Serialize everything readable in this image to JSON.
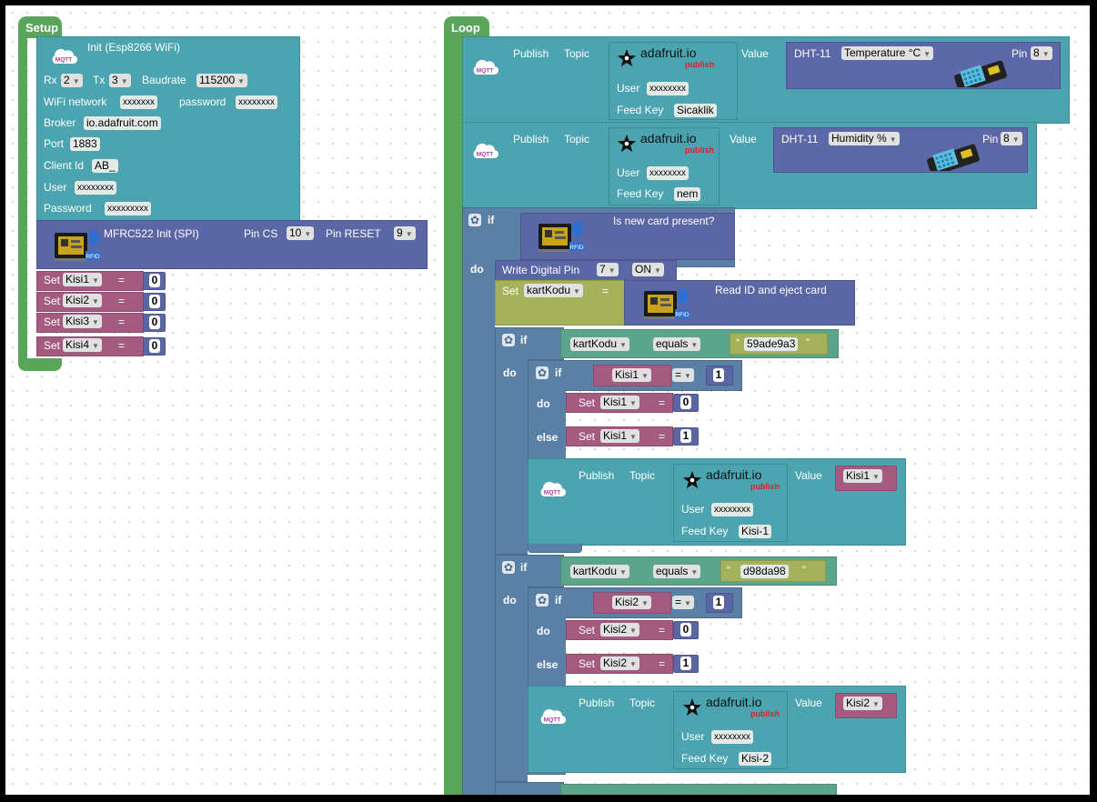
{
  "setup": {
    "label": "Setup",
    "init_title": "Init (Esp8266 WiFi)",
    "mqtt_label": "MQTT",
    "rx_label": "Rx",
    "rx_value": "2",
    "tx_label": "Tx",
    "tx_value": "3",
    "baud_label": "Baudrate",
    "baud_value": "115200",
    "wifi_label": "WiFi network",
    "wifi_value": "xxxxxxx",
    "password_label": "password",
    "password_value": "xxxxxxxx",
    "broker_label": "Broker",
    "broker_value": "io.adafruit.com",
    "port_label": "Port",
    "port_value": "1883",
    "client_label": "Client Id",
    "client_value": "AB_",
    "user_label": "User",
    "user_value": "xxxxxxxx",
    "pass2_label": "Password",
    "pass2_value": "xxxxxxxxx",
    "rfid_title": "MFRC522 Init (SPI)",
    "pin_cs_label": "Pin CS",
    "pin_cs_value": "10",
    "pin_reset_label": "Pin RESET",
    "pin_reset_value": "9",
    "rfid_tag": "RFID",
    "set_label": "Set",
    "eq": "=",
    "vars": [
      {
        "name": "Kisi1",
        "value": "0"
      },
      {
        "name": "Kisi2",
        "value": "0"
      },
      {
        "name": "Kisi3",
        "value": "0"
      },
      {
        "name": "Kisi4",
        "value": "0"
      }
    ]
  },
  "loop": {
    "label": "Loop",
    "publish_label": "Publish",
    "topic_label": "Topic",
    "value_label": "Value",
    "adafruit": "adafruit.io",
    "adafruit_sub": "publish",
    "user_label": "User",
    "feed_label": "Feed Key",
    "user_value": "xxxxxxxx",
    "pub1": {
      "feed": "Sicaklik",
      "sensor": "DHT-11",
      "measure": "Temperature °C",
      "pin_label": "Pin",
      "pin": "8"
    },
    "pub2": {
      "feed": "nem",
      "sensor": "DHT-11",
      "measure": "Humidity %",
      "pin_label": "Pin",
      "pin": "8"
    },
    "if_label": "if",
    "do_label": "do",
    "else_label": "else",
    "card_present": "Is new card present?",
    "write_pin_label": "Write Digital Pin",
    "write_pin": "7",
    "write_state": "ON",
    "set_label": "Set",
    "kart_var": "kartKodu",
    "eq": "=",
    "read_id": "Read ID and eject card",
    "equals": "equals",
    "q_open": "“",
    "q_close": "”",
    "card1": "59ade9a3",
    "card2": "d98da98",
    "kisi1": {
      "name": "Kisi1",
      "cmp": "=",
      "one": "1",
      "zero": "0",
      "feed": "Kisi-1"
    },
    "kisi2": {
      "name": "Kisi2",
      "cmp": "=",
      "one": "1",
      "zero": "0",
      "feed": "Kisi-2"
    }
  }
}
